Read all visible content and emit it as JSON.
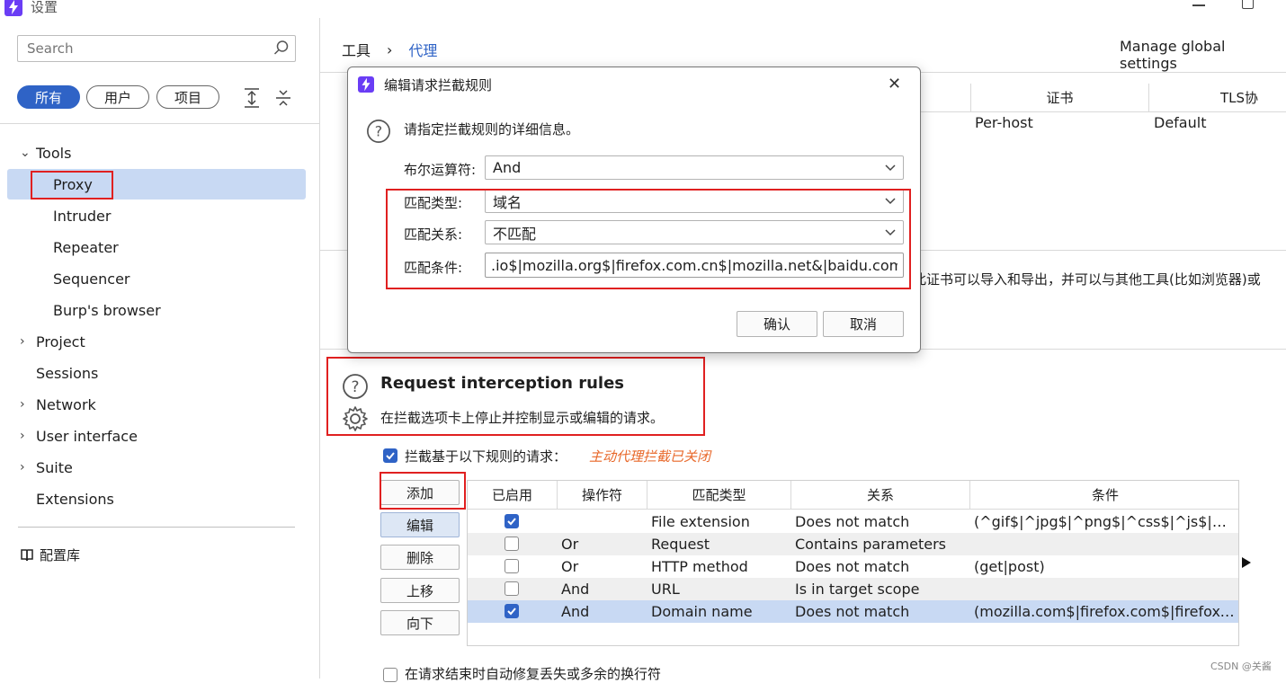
{
  "window": {
    "title": "设置"
  },
  "sidebar": {
    "search_placeholder": "Search",
    "filters": [
      "所有",
      "用户",
      "项目"
    ],
    "items": [
      {
        "label": "Tools",
        "chevron": "⌄"
      },
      {
        "label": "Proxy"
      },
      {
        "label": "Intruder"
      },
      {
        "label": "Repeater"
      },
      {
        "label": "Sequencer"
      },
      {
        "label": "Burp's browser"
      },
      {
        "label": "Project",
        "chevron": "›"
      },
      {
        "label": "Sessions"
      },
      {
        "label": "Network",
        "chevron": "›"
      },
      {
        "label": "User interface",
        "chevron": "›"
      },
      {
        "label": "Suite",
        "chevron": "›"
      },
      {
        "label": "Extensions"
      }
    ],
    "library_label": "配置库"
  },
  "header": {
    "breadcrumb": [
      "工具",
      "代理"
    ],
    "manage_global": "Manage global settings"
  },
  "background_table": {
    "headers": [
      "证书",
      "TLS协"
    ],
    "row": [
      "Per-host",
      "Default"
    ]
  },
  "background_text": "此证书可以导入和导出，并可以与其他工具(比如浏览器)或",
  "section": {
    "title": "Request interception rules",
    "description": "在拦截选项卡上停止并控制显示或编辑的请求。",
    "intercept_label": "拦截基于以下规则的请求：",
    "intercept_status": "主动代理拦截已关闭"
  },
  "buttons": {
    "add": "添加",
    "edit": "编辑",
    "remove": "删除",
    "up": "上移",
    "down": "向下"
  },
  "rules_table": {
    "headers": [
      "已启用",
      "操作符",
      "匹配类型",
      "关系",
      "条件"
    ],
    "rows": [
      {
        "enabled": true,
        "operator": "",
        "match_type": "File extension",
        "relationship": "Does not match",
        "condition": "(^gif$|^jpg$|^png$|^css$|^js$|^ico..."
      },
      {
        "enabled": false,
        "operator": "Or",
        "match_type": "Request",
        "relationship": "Contains parameters",
        "condition": ""
      },
      {
        "enabled": false,
        "operator": "Or",
        "match_type": "HTTP method",
        "relationship": "Does not match",
        "condition": "(get|post)"
      },
      {
        "enabled": false,
        "operator": "And",
        "match_type": "URL",
        "relationship": "Is in target scope",
        "condition": ""
      },
      {
        "enabled": true,
        "operator": "And",
        "match_type": "Domain name",
        "relationship": "Does not match",
        "condition": "(mozilla.com$|firefox.com$|firefoxchi..."
      }
    ]
  },
  "bottom_option": "在请求结束时自动修复丢失或多余的换行符",
  "watermark": "CSDN @关酱",
  "dialog": {
    "title": "编辑请求拦截规则",
    "info": "请指定拦截规则的详细信息。",
    "boolean_label": "布尔运算符:",
    "boolean_value": "And",
    "match_type_label": "匹配类型:",
    "match_type_value": "域名",
    "relationship_label": "匹配关系:",
    "relationship_value": "不匹配",
    "condition_label": "匹配条件:",
    "condition_value": ".io$|mozilla.org$|firefox.com.cn$|mozilla.net&|baidu.com&)",
    "ok": "确认",
    "cancel": "取消"
  },
  "colors": {
    "accent": "#2f63c6",
    "selection": "#c8d9f3",
    "highlight_red": "#e02020",
    "status_orange": "#e8682a",
    "logo_purple": "#6a3df5"
  }
}
